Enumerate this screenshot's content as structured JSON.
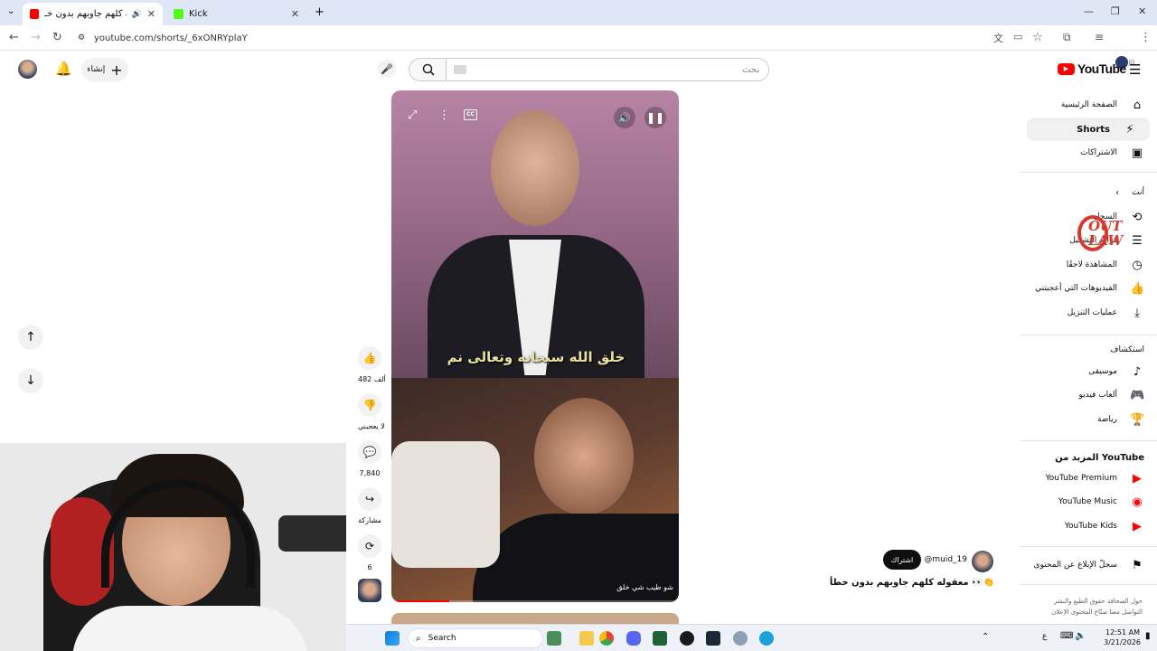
{
  "browser": {
    "tabs": [
      {
        "title": "معقوله كلهم جاوبهم بدون خـ",
        "active": true
      },
      {
        "title": "Kick",
        "active": false
      }
    ],
    "url": "youtube.com/shorts/_6xONRYplaY"
  },
  "header": {
    "create_label": "إنشاء",
    "search_placeholder": "بحث",
    "logo_text": "YouTube",
    "country_code": "JO"
  },
  "sidebar": {
    "main": [
      {
        "label": "الصفحة الرئيسية",
        "icon": "home-icon"
      },
      {
        "label": "Shorts",
        "icon": "shorts-icon",
        "active": true
      },
      {
        "label": "الاشتراكات",
        "icon": "subscriptions-icon"
      }
    ],
    "you_heading": "أنت",
    "you_items": [
      {
        "label": "السجل",
        "icon": "history-icon"
      },
      {
        "label": "قوائم التشغيل",
        "icon": "playlist-icon"
      },
      {
        "label": "المشاهدة لاحقًا",
        "icon": "watch-later-icon"
      },
      {
        "label": "الفيديوهات التي أعجبتني",
        "icon": "like-icon"
      },
      {
        "label": "عمليات التنزيل",
        "icon": "download-icon"
      }
    ],
    "explore_heading": "استكشاف",
    "explore_items": [
      {
        "label": "موسيقى",
        "icon": "music-icon"
      },
      {
        "label": "ألعاب فيديو",
        "icon": "gaming-icon"
      },
      {
        "label": "رياضة",
        "icon": "trophy-icon"
      }
    ],
    "more_heading": "المزيد من YouTube",
    "more_items": [
      {
        "label": "YouTube Premium"
      },
      {
        "label": "YouTube Music"
      },
      {
        "label": "YouTube Kids"
      }
    ],
    "report_label": "سجلّ الإبلاغ عن المحتوى",
    "footer_line1": "حول  الصحافة  حقوق الطبع والنشر",
    "footer_line2": "التواصل معنا  صنّاع المحتوى  الإعلان"
  },
  "short": {
    "caption_top": "خلق الله سبحانه وتعالى نم",
    "caption_bottom": "شو طيب شي خلق",
    "cc_label": "CC",
    "channel": "@muid_19",
    "subscribe_label": "اشتراك",
    "title": "معقوله كلهم جاوبهم بدون خطأ 👀👏",
    "likes": "482 ألف",
    "dislike_label": "لا يعجبني",
    "comments": "7,840",
    "share_label": "مشاركة",
    "remix_count": "6"
  },
  "overlay_logo": "OUT LAW",
  "taskbar": {
    "search_label": "Search",
    "time": "12:51 AM",
    "date": "3/21/2026",
    "lang": "ع"
  },
  "colors": {
    "youtube_red": "#ff0000",
    "tab_bg": "#dfe6f5"
  }
}
